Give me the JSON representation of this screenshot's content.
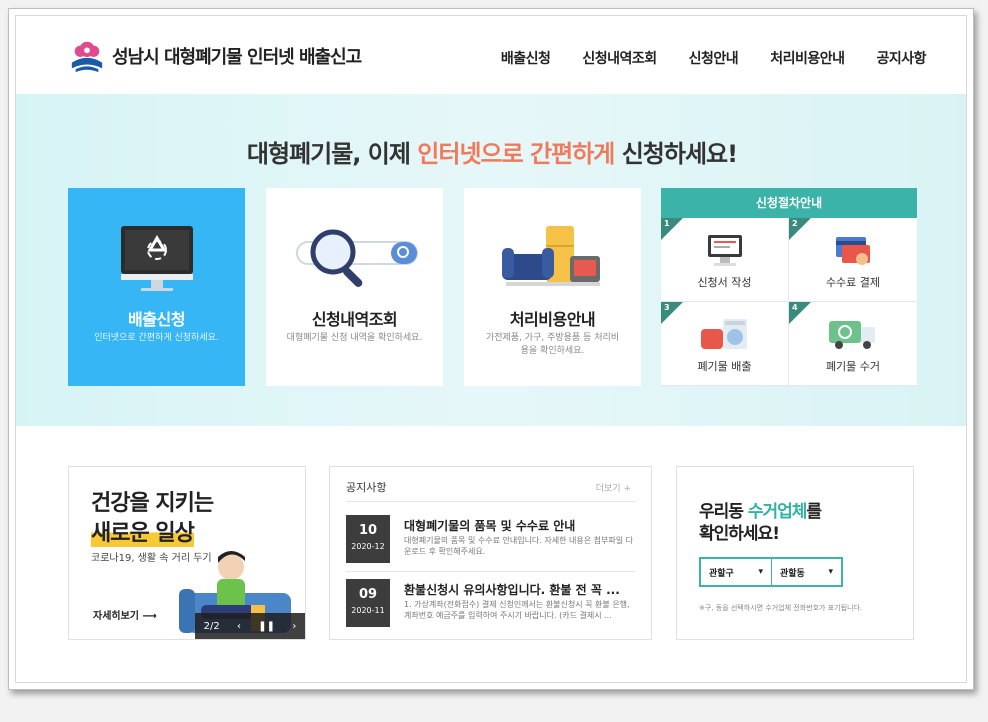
{
  "header": {
    "site_title": "성남시 대형폐기물 인터넷 배출신고",
    "nav": [
      "배출신청",
      "신청내역조회",
      "신청안내",
      "처리비용안내",
      "공지사항"
    ]
  },
  "hero": {
    "title_pre": "대형폐기물, 이제 ",
    "title_highlight": "인터넷으로 간편하게",
    "title_post": " 신청하세요!",
    "cards": [
      {
        "title": "배출신청",
        "desc": "인터넷으로 간편하게 신청하세요."
      },
      {
        "title": "신청내역조회",
        "desc": "대형폐기물 신청 내역을 확인하세요."
      },
      {
        "title": "처리비용안내",
        "desc": "가전제품, 가구, 주방용품 등 처리비용을 확인하세요."
      }
    ],
    "process": {
      "title": "신청절차안내",
      "steps": [
        {
          "num": "1",
          "label": "신청서 작성"
        },
        {
          "num": "2",
          "label": "수수료 결제"
        },
        {
          "num": "3",
          "label": "폐기물 배출"
        },
        {
          "num": "4",
          "label": "폐기물 수거"
        }
      ]
    }
  },
  "banner": {
    "line1": "건강을 지키는",
    "line2": "새로운 일상",
    "line3": "코로나19, 생활 속 거리 두기",
    "more": "자세히보기",
    "pager": "2/2"
  },
  "notice": {
    "title": "공지사항",
    "more": "더보기 +",
    "items": [
      {
        "day": "10",
        "ym": "2020-12",
        "title": "대형폐기물의 품목 및 수수료 안내",
        "desc": "대형폐기물의 품목 및 수수료 안내입니다. 자세한 내용은 첨부파일 다운로드 후 확인해주세요."
      },
      {
        "day": "09",
        "ym": "2020-11",
        "title": "환불신청시 유의사항입니다. 환불 전 꼭 ...",
        "desc": "1. 가상계좌(전화접수) 결제 신청인께서는 환불신청시 꼭 환불 은행,계좌번호 예금주를 입력하여 주시기 바랍니다. (카드 결제시 ..."
      }
    ]
  },
  "haul": {
    "line1_pre": "우리동 ",
    "line1_highlight": "수거업체",
    "line1_post": "를",
    "line2": "확인하세요!",
    "select_gu": "관할구",
    "select_dong": "관할동",
    "note": "※구, 동을 선택하시면 수거업체 전화번호가 표기됩니다."
  },
  "colors": {
    "accent_teal": "#3bb3a8",
    "accent_blue": "#37b6f5",
    "highlight_orange": "#f07b5a"
  }
}
